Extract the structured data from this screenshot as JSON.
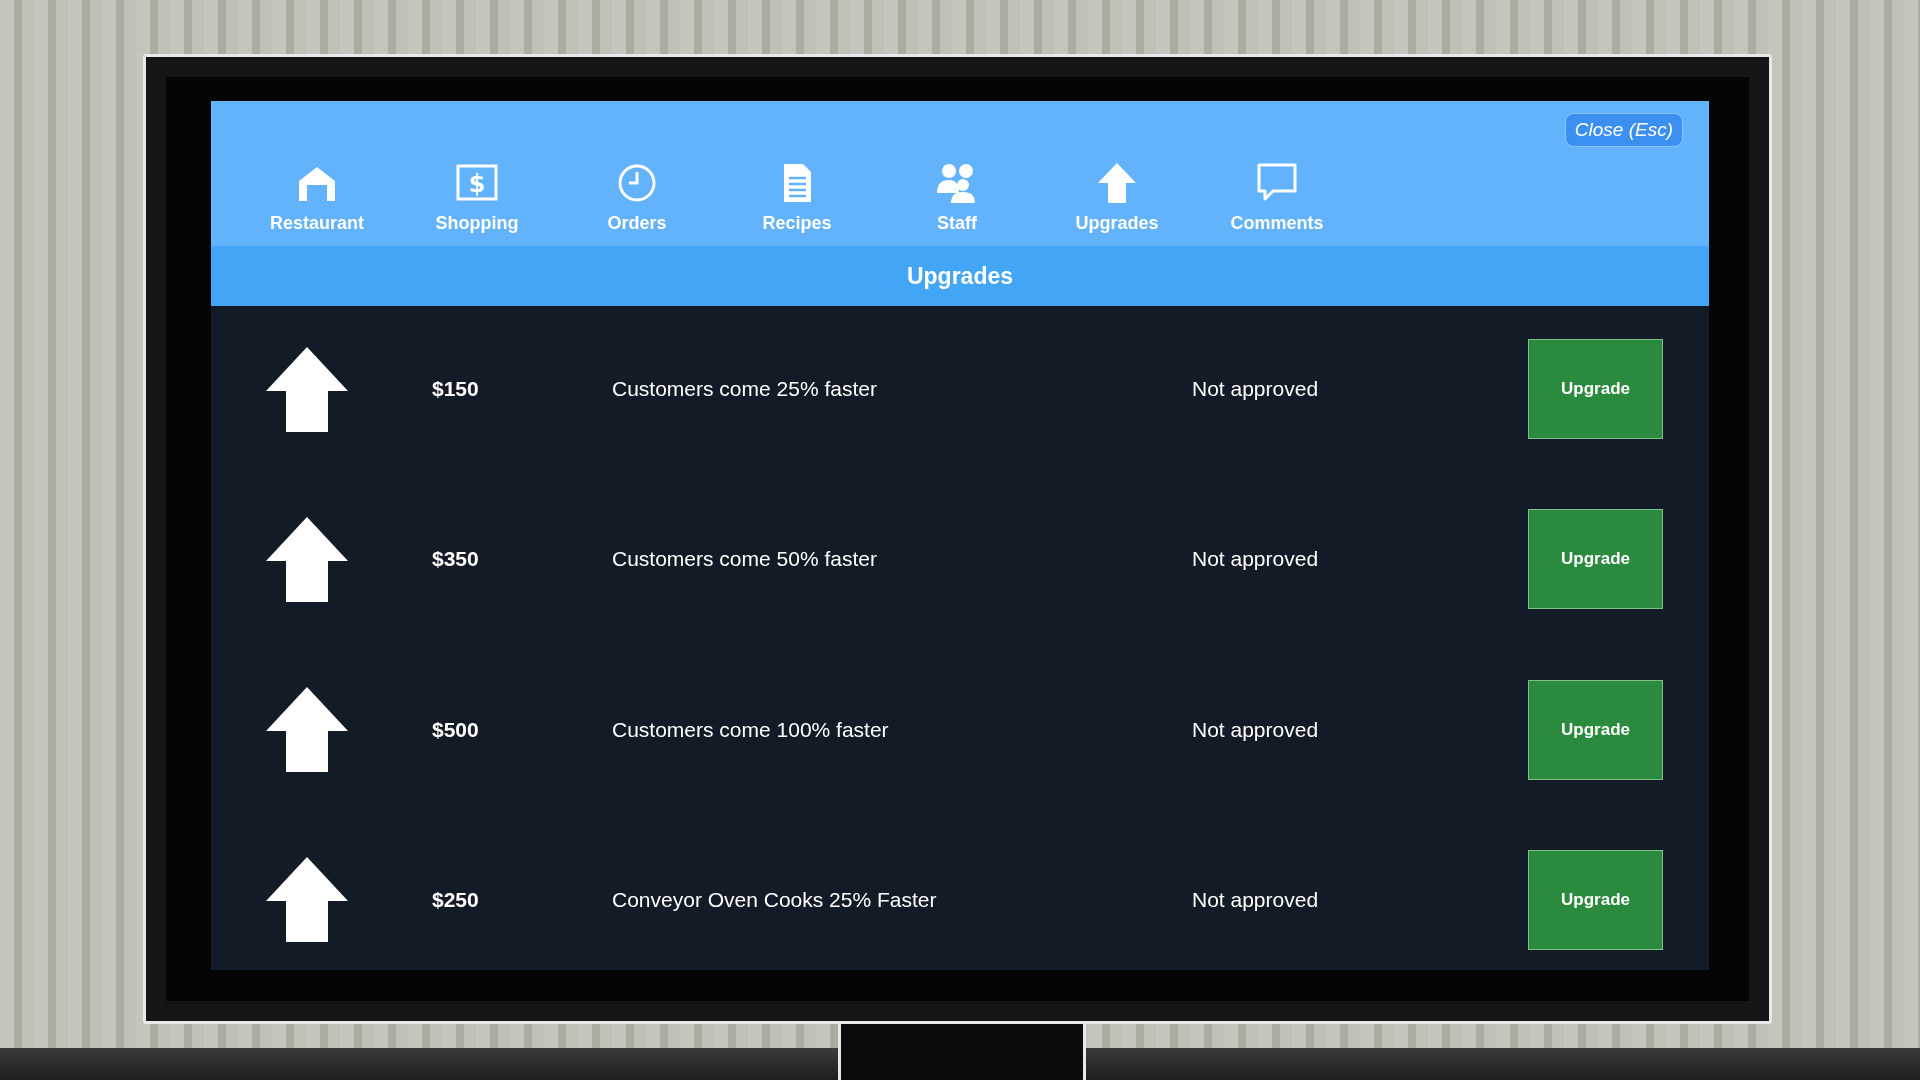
{
  "close_button": "Close (Esc)",
  "nav_tabs": [
    {
      "label": "Restaurant"
    },
    {
      "label": "Shopping",
      "icon_glyph": "$"
    },
    {
      "label": "Orders"
    },
    {
      "label": "Recipes"
    },
    {
      "label": "Staff"
    },
    {
      "label": "Upgrades"
    },
    {
      "label": "Comments"
    }
  ],
  "page_title": "Upgrades",
  "upgrades": [
    {
      "price": "$150",
      "description": "Customers come 25% faster",
      "status": "Not approved",
      "button": "Upgrade"
    },
    {
      "price": "$350",
      "description": "Customers come 50% faster",
      "status": "Not approved",
      "button": "Upgrade"
    },
    {
      "price": "$500",
      "description": "Customers come 100% faster",
      "status": "Not approved",
      "button": "Upgrade"
    },
    {
      "price": "$250",
      "description": "Conveyor Oven Cooks 25% Faster",
      "status": "Not approved",
      "button": "Upgrade"
    }
  ]
}
